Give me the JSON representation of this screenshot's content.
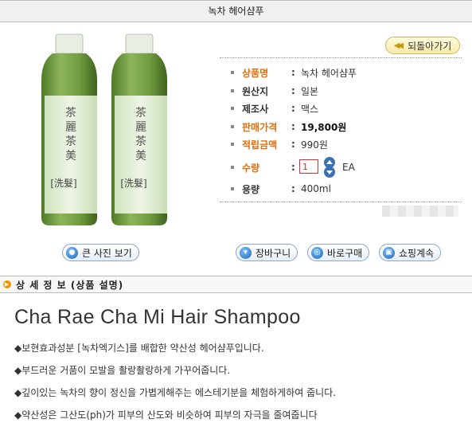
{
  "header": {
    "title": "녹차 헤어샴푸"
  },
  "product_image": {
    "bottle_text": "茶麗茶美",
    "label_text": "洗髮"
  },
  "back_button": {
    "label": "되돌아가기"
  },
  "info": {
    "name": {
      "label": "상품명",
      "value": "녹차 헤어샴푸"
    },
    "origin": {
      "label": "원산지",
      "value": "일본"
    },
    "maker": {
      "label": "제조사",
      "value": "맥스"
    },
    "price": {
      "label": "판매가격",
      "value": "19,800원"
    },
    "points": {
      "label": "적립금액",
      "value": "990원"
    },
    "quantity": {
      "label": "수량",
      "value": "1",
      "unit": "EA"
    },
    "volume": {
      "label": "용량",
      "value": "400ml"
    }
  },
  "buttons": {
    "big_photo": "큰 사진 보기",
    "cart": "장바구니",
    "buy_now": "바로구매",
    "continue_shopping": "쇼핑계속"
  },
  "detail": {
    "section_title": "상 세 정 보 (상품 설명)",
    "heading": "Cha Rae Cha Mi Hair Shampoo",
    "lines": [
      "◆보현효과성분 [녹차엑기스]를 배합한 약산성 헤어샴푸입니다.",
      "◆부드러운 거품이 모발을 촬랑촬랑하게 가꾸어줍니다.",
      "◆깊이있는 녹차의 향이 정신을 가볍게해주는 에스테기분을 체험하게하여 줍니다.",
      "◆약산성은 그산도(ph)가 피부의 산도와 비슷하여 피부의 자극을 줄여줍니다"
    ]
  },
  "colors": {
    "accent": "#e46c0a",
    "button_border": "#8aa6c8",
    "bottle": "#6f9a3e"
  },
  "icons": {
    "back": "double-chevron-left-icon",
    "big_photo": "magnifier-icon",
    "cart": "cart-icon",
    "buy_now": "target-icon",
    "continue_shopping": "shop-icon",
    "stepper": "up-down-arrow-icon",
    "section": "chevron-right-circle-icon"
  }
}
